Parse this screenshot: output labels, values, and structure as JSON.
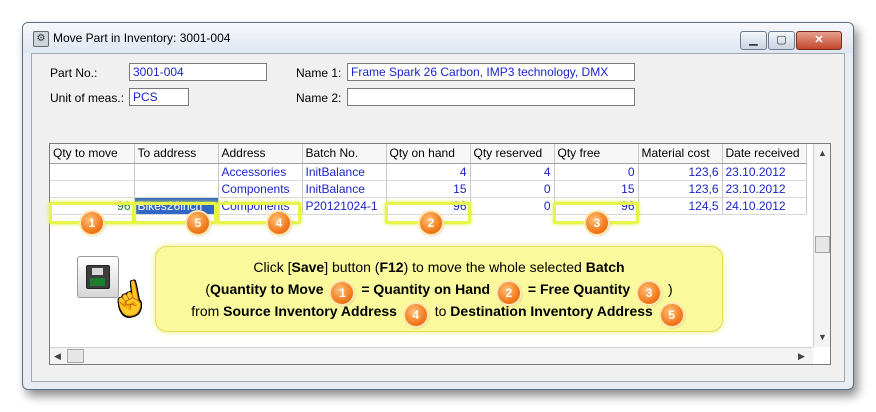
{
  "window": {
    "title": "Move Part in Inventory: 3001-004",
    "min_glyph": "▁",
    "max_glyph": "▢",
    "close_glyph": "✕"
  },
  "form": {
    "part_no_label": "Part No.:",
    "part_no_value": "3001-004",
    "unit_label": "Unit of meas.:",
    "unit_value": "PCS",
    "name1_label": "Name 1:",
    "name1_value": "Frame Spark 26 Carbon, IMP3 technology, DMX",
    "name2_label": "Name 2:",
    "name2_value": ""
  },
  "grid": {
    "columns": [
      "Qty to move",
      "To address",
      "Address",
      "Batch No.",
      "Qty on hand",
      "Qty reserved",
      "Qty free",
      "Material cost",
      "Date received"
    ],
    "rows": [
      [
        "",
        "",
        "Accessories",
        "InitBalance",
        "4",
        "4",
        "0",
        "123,6",
        "23.10.2012"
      ],
      [
        "",
        "",
        "Components",
        "InitBalance",
        "15",
        "0",
        "15",
        "123,6",
        "23.10.2012"
      ],
      [
        "96",
        "Bikes26inch",
        "Components",
        "P20121024-1",
        "96",
        "0",
        "96",
        "124,5",
        "24.10.2012"
      ]
    ]
  },
  "callout": {
    "line1_pre": "Click [",
    "line1_save": "Save",
    "line1_mid": "] button (",
    "line1_key": "F12",
    "line1_post": ") to move the whole selected ",
    "line1_batch": "Batch",
    "line2_open": "(",
    "qty_to_move": "Quantity to Move",
    "eq1": "=",
    "qty_on_hand": "Quantity on Hand",
    "eq2": "=",
    "free_qty": "Free Quantity",
    "line2_close": ")",
    "line3_from": "from",
    "source_addr": "Source Inventory Address",
    "line3_to": "to",
    "dest_addr": "Destination Inventory Address"
  },
  "badges": [
    "1",
    "2",
    "3",
    "4",
    "5"
  ],
  "icons": {
    "save": "floppy-disk-icon",
    "pointer": "hand-pointer-icon",
    "hand_glyph": "☝",
    "up_arrow": "▲",
    "down_arrow": "▼",
    "left_arrow": "◀",
    "right_arrow": "▶"
  },
  "colors": {
    "highlight": "#e7f54a",
    "badge": "#f27a1c",
    "callout": "#fafa9c",
    "link_blue": "#1a24c8",
    "qty_green": "#1a7a1a",
    "selection": "#3166c6"
  }
}
